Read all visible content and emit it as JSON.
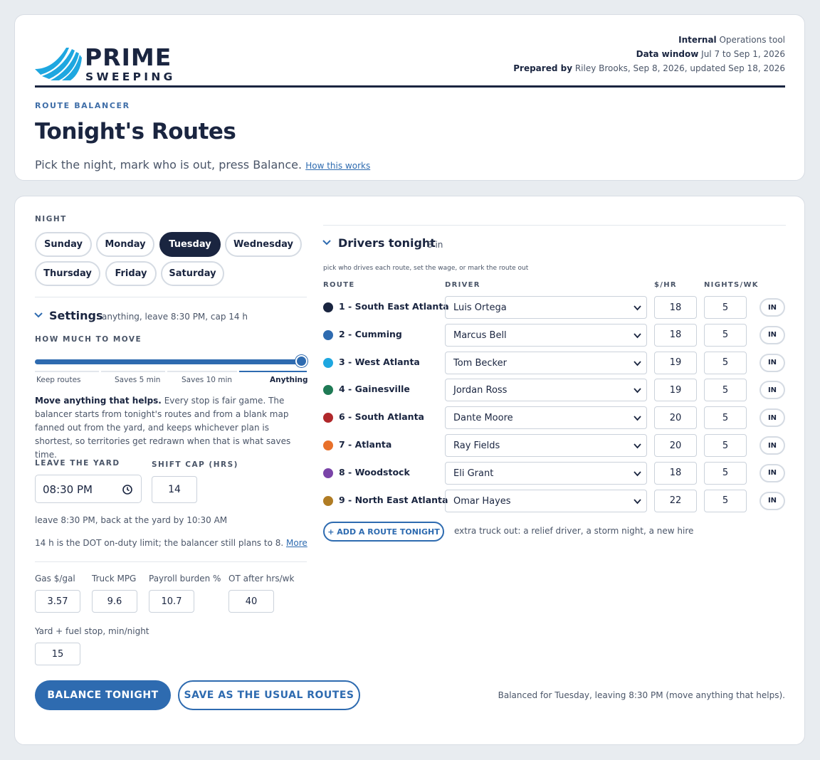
{
  "brand": {
    "line1": "PRIME",
    "line2": "SWEEPING"
  },
  "meta": {
    "internal_label": "Internal",
    "internal_value": " Operations tool",
    "window_label": "Data window",
    "window_value": " Jul 7 to Sep 1, 2026",
    "prepared_label": "Prepared by",
    "prepared_value": " Riley Brooks, Sep 8, 2026, updated Sep 18, 2026"
  },
  "page": {
    "eyebrow": "ROUTE BALANCER",
    "title": "Tonight's Routes",
    "subtitle": "Pick the night, mark who is out, press Balance.",
    "how_link": "How this works"
  },
  "night": {
    "label": "NIGHT",
    "days": [
      "Sunday",
      "Monday",
      "Tuesday",
      "Wednesday",
      "Thursday",
      "Friday",
      "Saturday"
    ],
    "selected": "Tuesday"
  },
  "settings": {
    "title": "Settings",
    "summary": "anything, leave 8:30 PM, cap 14 h",
    "move_label": "HOW MUCH TO MOVE",
    "move_level": 1.0,
    "move_ticks": [
      "Keep routes",
      "Saves 5 min",
      "Saves 10 min",
      "Anything"
    ],
    "move_selected": "Anything",
    "desc_bold": "Move anything that helps.",
    "desc_rest": " Every stop is fair game. The balancer starts from tonight's routes and from a blank map fanned out from the yard, and keeps whichever plan is shortest, so territories get redrawn when that is what saves time.",
    "leave_label": "LEAVE THE YARD",
    "leave_value": "08:30 PM",
    "cap_label": "SHIFT CAP (HRS)",
    "cap_value": "14",
    "back_note": "leave 8:30 PM, back at the yard by 10:30 AM",
    "dot_note": "14 h is the DOT on-duty limit; the balancer still plans to 8.",
    "dot_more": "More",
    "gas_label": "Gas $/gal",
    "gas_value": "3.57",
    "mpg_label": "Truck MPG",
    "mpg_value": "9.6",
    "burden_label": "Payroll burden %",
    "burden_value": "10.7",
    "ot_label": "OT after hrs/wk",
    "ot_value": "40",
    "yard_label": "Yard + fuel stop, min/night",
    "yard_value": "15"
  },
  "actions": {
    "balance": "BALANCE TONIGHT",
    "save": "SAVE AS THE USUAL ROUTES",
    "status": "Balanced for Tuesday, leaving 8:30 PM (move anything that helps)."
  },
  "drivers": {
    "title": "Drivers tonight",
    "count": "8 in",
    "hint": "pick who drives each route, set the wage, or mark the route out",
    "headers": {
      "route": "ROUTE",
      "driver": "DRIVER",
      "wage": "$/HR",
      "nights": "NIGHTS/WK"
    },
    "rows": [
      {
        "route": "1 - South East Atlanta",
        "color": "#1a2540",
        "driver": "Luis Ortega",
        "wage": "18",
        "nights": "5",
        "status": "IN"
      },
      {
        "route": "2 - Cumming",
        "color": "#2e6bb0",
        "driver": "Marcus Bell",
        "wage": "18",
        "nights": "5",
        "status": "IN"
      },
      {
        "route": "3 - West Atlanta",
        "color": "#1ea7e0",
        "driver": "Tom Becker",
        "wage": "19",
        "nights": "5",
        "status": "IN"
      },
      {
        "route": "4 - Gainesville",
        "color": "#1f7a55",
        "driver": "Jordan Ross",
        "wage": "19",
        "nights": "5",
        "status": "IN"
      },
      {
        "route": "6 - South Atlanta",
        "color": "#b0282b",
        "driver": "Dante Moore",
        "wage": "20",
        "nights": "5",
        "status": "IN"
      },
      {
        "route": "7 - Atlanta",
        "color": "#e8702a",
        "driver": "Ray Fields",
        "wage": "20",
        "nights": "5",
        "status": "IN"
      },
      {
        "route": "8 - Woodstock",
        "color": "#7a44a8",
        "driver": "Eli Grant",
        "wage": "18",
        "nights": "5",
        "status": "IN"
      },
      {
        "route": "9 - North East Atlanta",
        "color": "#b07c24",
        "driver": "Omar Hayes",
        "wage": "22",
        "nights": "5",
        "status": "IN"
      }
    ],
    "add_label": "+ ADD A ROUTE TONIGHT",
    "add_note": "extra truck out: a relief driver, a storm night, a new hire"
  },
  "colors": {
    "accent": "#2e6bb0",
    "navy": "#1a2540",
    "logo": "#1ea7e0"
  }
}
